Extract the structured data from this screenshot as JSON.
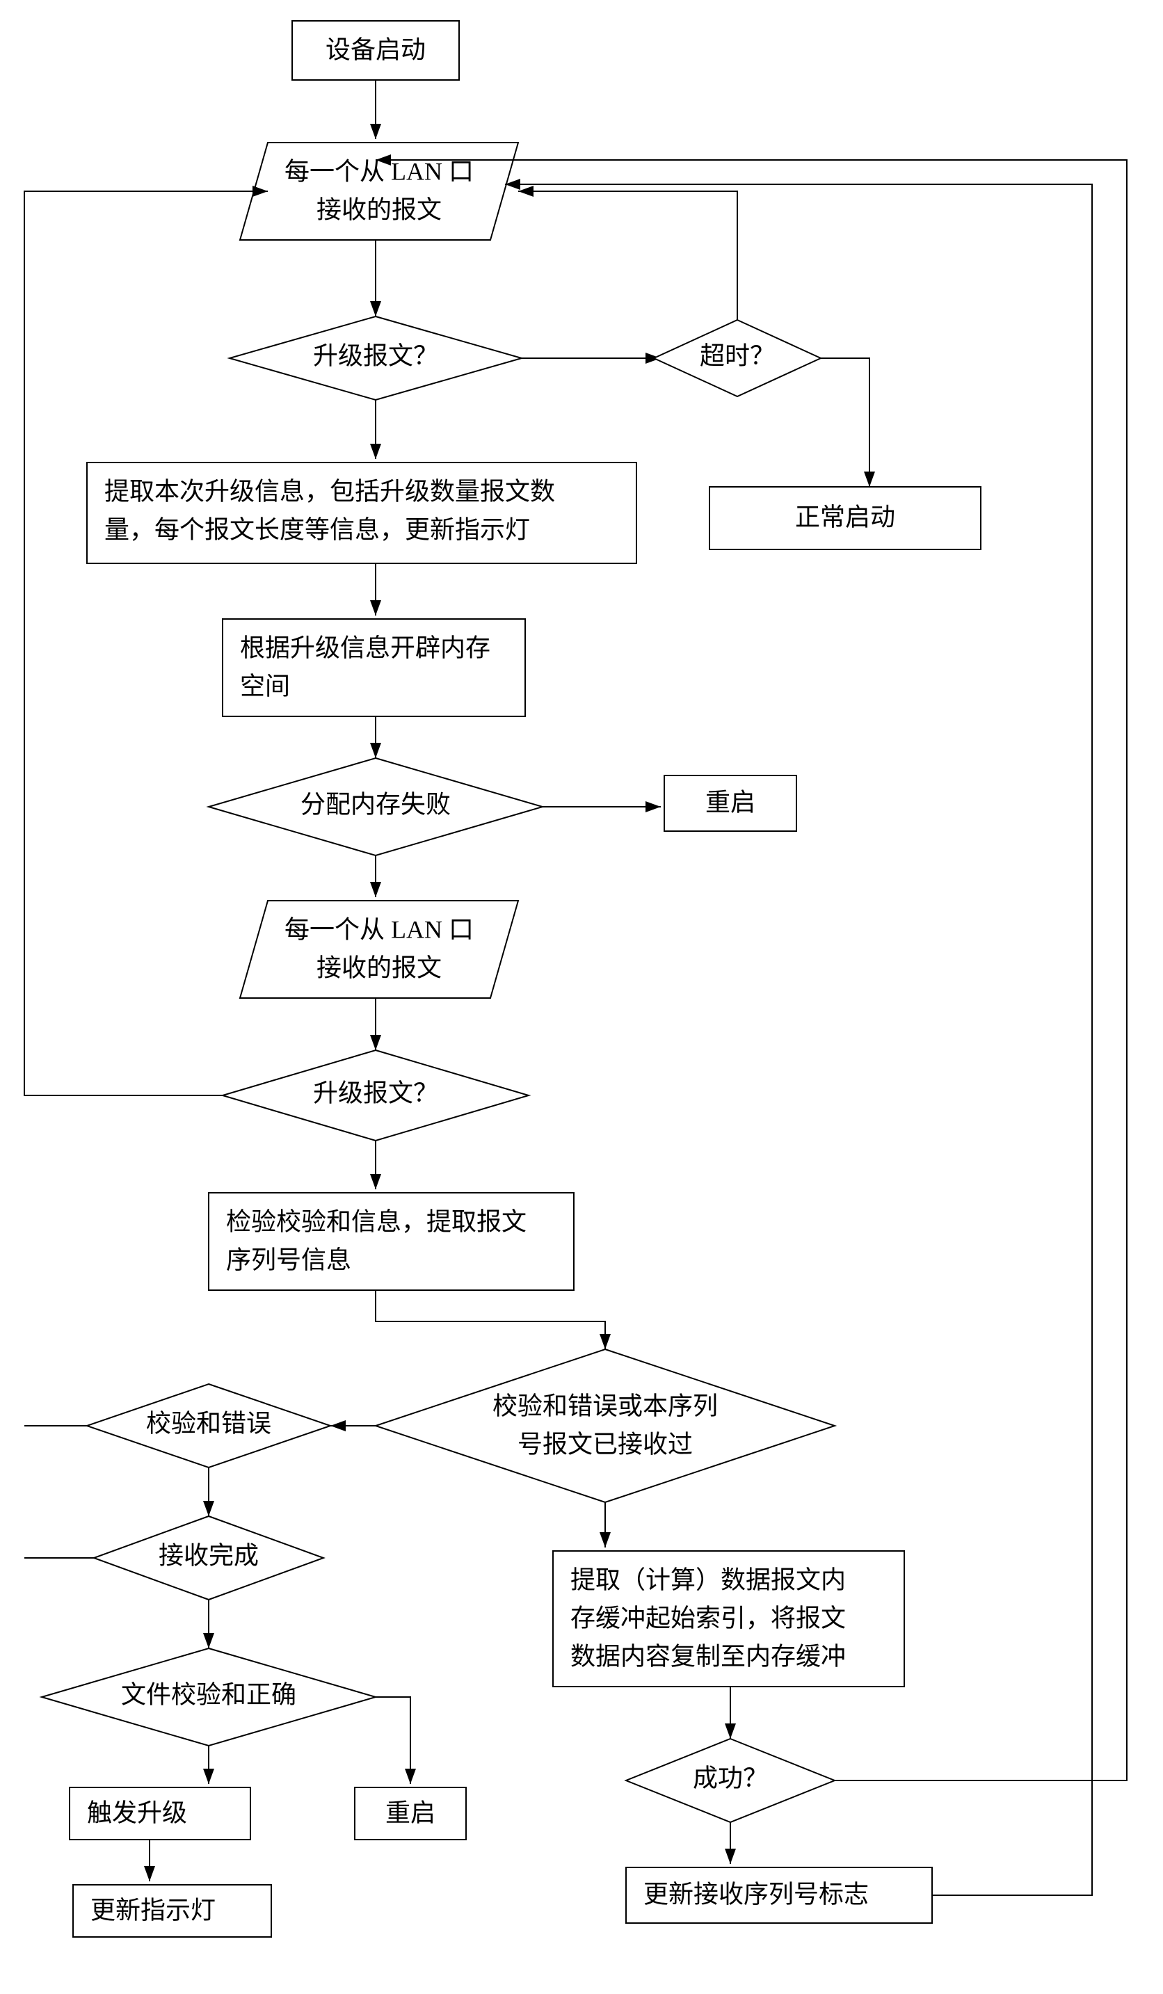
{
  "flowchart": {
    "start": "设备启动",
    "lan_rx_1_l1": "每一个从 LAN 口",
    "lan_rx_1_l2": "接收的报文",
    "dec_upgrade_1": "升级报文？",
    "dec_timeout": "超时？",
    "normal_start": "正常启动",
    "extract_l1": "提取本次升级信息，包括升级数量报文数",
    "extract_l2": "量，每个报文长度等信息，更新指示灯",
    "alloc_l1": "根据升级信息开辟内存",
    "alloc_l2": "空间",
    "dec_alloc_fail": "分配内存失败",
    "restart1": "重启",
    "lan_rx_2_l1": "每一个从 LAN 口",
    "lan_rx_2_l2": "接收的报文",
    "dec_upgrade_2": "升级报文？",
    "verify_l1": "检验校验和信息，提取报文",
    "verify_l2": "序列号信息",
    "dec_chk_dup_l1": "校验和错误或本序列",
    "dec_chk_dup_l2": "号报文已接收过",
    "dec_chk_err": "校验和错误",
    "dec_recv_done": "接收完成",
    "copy_l1": "提取（计算）数据报文内",
    "copy_l2": "存缓冲起始索引，将报文",
    "copy_l3": "数据内容复制至内存缓冲",
    "dec_file_ok": "文件校验和正确",
    "dec_success": "成功？",
    "trigger": "触发升级",
    "restart2": "重启",
    "update_led": "更新指示灯",
    "update_seq": "更新接收序列号标志"
  }
}
